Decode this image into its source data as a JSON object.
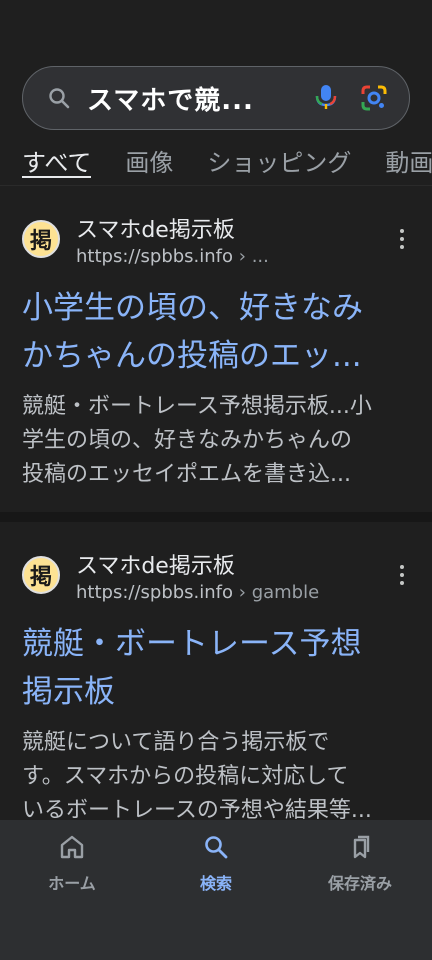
{
  "search": {
    "query": "スマホで競..."
  },
  "tabs": [
    {
      "label": "すべて",
      "active": true
    },
    {
      "label": "画像",
      "active": false
    },
    {
      "label": "ショッピング",
      "active": false
    },
    {
      "label": "動画",
      "active": false
    }
  ],
  "results": [
    {
      "favicon_char": "掲",
      "site_name": "スマホde掲示板",
      "url_host": "https://spbbs.info",
      "url_path": " › ...",
      "title_lines": [
        "小学生の頃の、好きなみ",
        "かちゃんの投稿のエッ..."
      ],
      "snippet_lines": [
        "競艇・ボートレース予想掲示板...小",
        "学生の頃の、好きなみかちゃんの",
        "投稿のエッセイポエムを書き込..."
      ]
    },
    {
      "favicon_char": "掲",
      "site_name": "スマホde掲示板",
      "url_host": "https://spbbs.info",
      "url_path": " › gamble",
      "title_lines": [
        "競艇・ボートレース予想",
        "掲示板"
      ],
      "snippet_lines": [
        "競艇について語り合う掲示板で",
        "す。スマホからの投稿に対応して",
        "いるボートレースの予想や結果等..."
      ]
    }
  ],
  "bottom_nav": [
    {
      "label": "ホーム",
      "icon": "home-icon",
      "active": false
    },
    {
      "label": "検索",
      "icon": "search-icon",
      "active": true
    },
    {
      "label": "保存済み",
      "icon": "saved-icon",
      "active": false
    }
  ],
  "colors": {
    "background": "#1f1f1f",
    "link": "#8ab4f8",
    "nav_bg": "#2d2f31"
  }
}
